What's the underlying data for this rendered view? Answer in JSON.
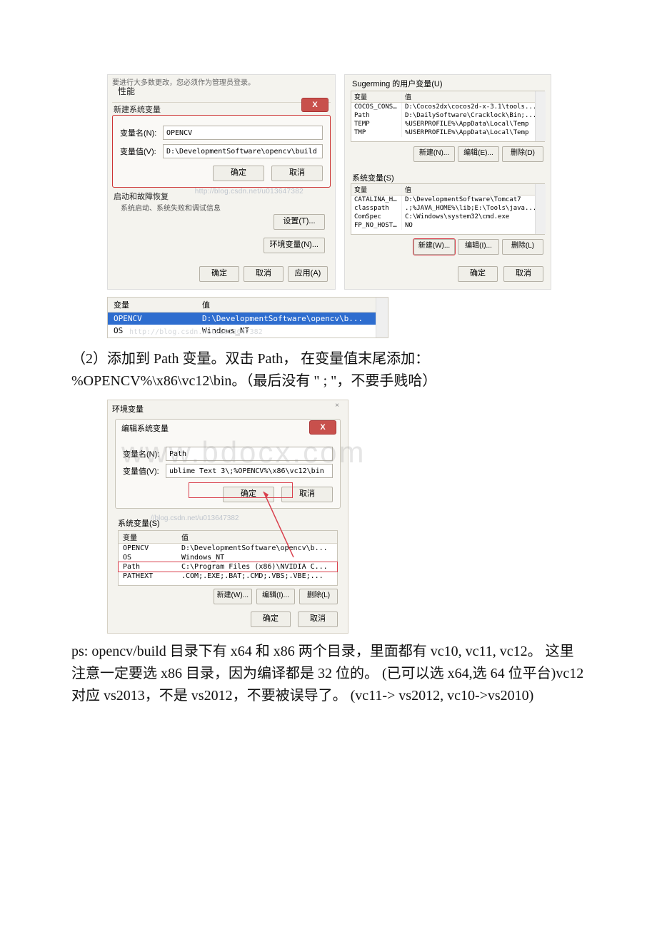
{
  "shot1": {
    "topNote": "要进行大多数更改，您必须作为管理员登录。",
    "perfLabel": "性能",
    "newVarTitle": "新建系统变量",
    "closeX": "X",
    "varNameLabel": "变量名(N):",
    "varNameValue": "OPENCV",
    "varValueLabel": "变量值(V):",
    "varValueValue": "D:\\DevelopmentSoftware\\opencv\\build",
    "ok": "确定",
    "cancel": "取消",
    "startupTitle": "启动和故障恢复",
    "startupSub": "系统启动、系统失败和调试信息",
    "settingsBtn": "设置(T)...",
    "envBtn": "环境变量(N)...",
    "apply": "应用(A)",
    "watermark": "http://blog.csdn.net/u013647382"
  },
  "shot1r": {
    "userVarsTitle": "Sugerming 的用户变量(U)",
    "varHdr": "变量",
    "valHdr": "值",
    "userVars": [
      {
        "name": "COCOS_CONSOL...",
        "value": "D:\\Cocos2dx\\cocos2d-x-3.1\\tools..."
      },
      {
        "name": "Path",
        "value": "D:\\DailySoftware\\Cracklock\\Bin;..."
      },
      {
        "name": "TEMP",
        "value": "%USERPROFILE%\\AppData\\Local\\Temp"
      },
      {
        "name": "TMP",
        "value": "%USERPROFILE%\\AppData\\Local\\Temp"
      }
    ],
    "newBtn": "新建(N)...",
    "editBtn": "编辑(E)...",
    "delBtn": "删除(D)",
    "sysVarsTitle": "系统变量(S)",
    "sysVars": [
      {
        "name": "CATALINA_HOME",
        "value": "D:\\DevelopmentSoftware\\Tomcat7"
      },
      {
        "name": "classpath",
        "value": ".;%JAVA_HOME%\\lib;E:\\Tools\\java..."
      },
      {
        "name": "ComSpec",
        "value": "C:\\Windows\\system32\\cmd.exe"
      },
      {
        "name": "FP_NO_HOST_C.",
        "value": "NO"
      }
    ],
    "newBtn2": "新建(W)...",
    "editBtn2": "编辑(I)...",
    "delBtn2": "删除(L)",
    "ok": "确定",
    "cancel": "取消",
    "watermark": "u013647382"
  },
  "strip": {
    "varHdr": "变量",
    "valHdr": "值",
    "rows": [
      {
        "name": "OPENCV",
        "value": "D:\\DevelopmentSoftware\\opencv\\b...",
        "sel": true
      },
      {
        "name": "OS",
        "value": "Windows_NT",
        "sel": false
      }
    ],
    "watermark": "http://blog.csdn.net/u013647382"
  },
  "para1": "（2）添加到 Path 变量。双击 Path， 在变量值末尾添加：%OPENCV%\\x86\\vc12\\bin。（最后没有 \" ; \"，不要手贱哈）",
  "shot2": {
    "title": "环境变量",
    "close": "×",
    "editTitle": "编辑系统变量",
    "closeX": "X",
    "varNameLabel": "变量名(N):",
    "varNameValue": "Path",
    "varValueLabel": "变量值(V):",
    "varValueValue": "ublime Text 3\\;%OPENCV%\\x86\\vc12\\bin",
    "ok": "确定",
    "cancel": "取消",
    "sysVarsTitle": "系统变量(S)",
    "varHdr": "变量",
    "valHdr": "值",
    "rows": [
      {
        "name": "OPENCV",
        "value": "D:\\DevelopmentSoftware\\opencv\\b..."
      },
      {
        "name": "OS",
        "value": "Windows_NT"
      },
      {
        "name": "Path",
        "value": "C:\\Program Files (x86)\\NVIDIA C...",
        "hl": true
      },
      {
        "name": "PATHEXT",
        "value": ".COM;.EXE;.BAT;.CMD;.VBS;.VBE;..."
      }
    ],
    "newBtn": "新建(W)...",
    "editBtn": "编辑(I)...",
    "delBtn": "删除(L)",
    "ok2": "确定",
    "cancel2": "取消",
    "watermark": "//blog.csdn.net/u013647382"
  },
  "bigWatermark": "www.bdocx.com",
  "para2": "ps: opencv/build 目录下有 x64 和 x86 两个目录，里面都有 vc10, vc11, vc12。 这里注意一定要选 x86 目录，因为编译都是 32 位的。 (已可以选 x64,选 64 位平台)vc12 对应 vs2013，不是 vs2012，不要被误导了。 (vc11-> vs2012, vc10->vs2010)"
}
